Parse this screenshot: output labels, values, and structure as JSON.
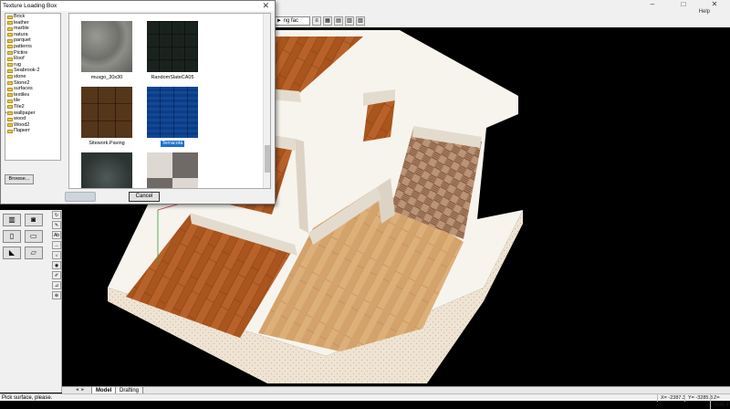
{
  "app": {
    "window_controls": [
      "–",
      "□",
      "✕"
    ],
    "help_label": "Help",
    "toolbar_select_value": "► ng fac"
  },
  "dialog": {
    "title": "Texture Loading Box",
    "close_glyph": "✕",
    "folders": [
      {
        "label": "Brick",
        "expandable": false
      },
      {
        "label": "leather",
        "expandable": false
      },
      {
        "label": "marble",
        "expandable": false
      },
      {
        "label": "natura",
        "expandable": false
      },
      {
        "label": "parquet",
        "expandable": false
      },
      {
        "label": "patterns",
        "expandable": false
      },
      {
        "label": "Pictire",
        "expandable": false
      },
      {
        "label": "Roof",
        "expandable": false
      },
      {
        "label": "rug",
        "expandable": false
      },
      {
        "label": "Seabrook-2",
        "expandable": false
      },
      {
        "label": "stone",
        "expandable": false
      },
      {
        "label": "Stone2",
        "expandable": false
      },
      {
        "label": "surfaces",
        "expandable": false
      },
      {
        "label": "textiles",
        "expandable": false
      },
      {
        "label": "tile",
        "expandable": false
      },
      {
        "label": "Tile2",
        "expandable": false
      },
      {
        "label": "wallpaper",
        "expandable": true
      },
      {
        "label": "wood",
        "expandable": false
      },
      {
        "label": "Wood2",
        "expandable": false
      },
      {
        "label": "Паркет",
        "expandable": false
      }
    ],
    "browse_label": "Browse...",
    "cancel_label": "Cancel",
    "textures": [
      {
        "label": "musgo_30x30",
        "selected": false,
        "swatch": "musgo"
      },
      {
        "label": "RandomSlateCA05",
        "selected": false,
        "swatch": "slate"
      },
      {
        "label": "Sitework.Paving",
        "selected": false,
        "swatch": "paving"
      },
      {
        "label": "Terracota",
        "selected": true,
        "swatch": "terracota"
      },
      {
        "label": "",
        "selected": false,
        "swatch": "granite"
      },
      {
        "label": "",
        "selected": false,
        "swatch": "ornament"
      }
    ]
  },
  "tabs": {
    "nav_glyphs": "◄ ►",
    "items": [
      {
        "label": "Model",
        "active": true
      },
      {
        "label": "Drafting",
        "active": false
      }
    ]
  },
  "status": {
    "message": "Pick surface, please.",
    "x": "X= -2387.3",
    "y": "Y= -3285.3",
    "z": "Z= 1045.4"
  },
  "colors": {
    "accent_selected": "#1c6fd0",
    "wood_dark": "#b05a1f",
    "wood_light": "#dcac72",
    "wall_top": "#ffffff",
    "wall_side": "#e8dfd3",
    "background": "#000000"
  }
}
